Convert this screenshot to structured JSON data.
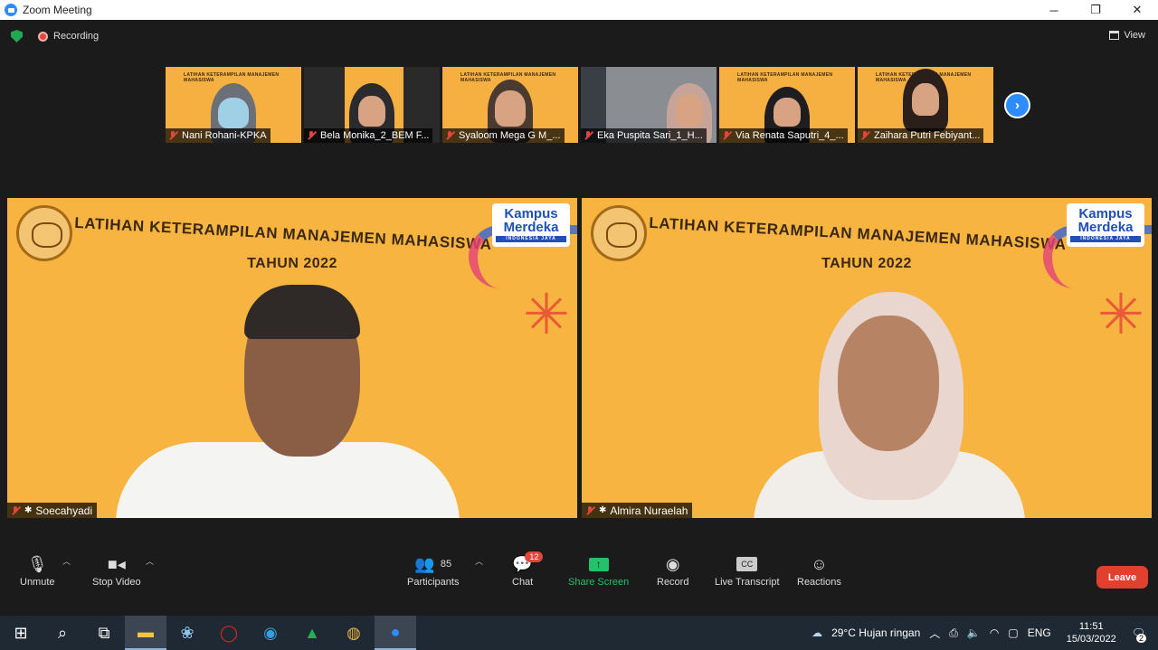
{
  "window": {
    "title": "Zoom Meeting",
    "minimize": "─",
    "maximize": "❐",
    "close": "✕"
  },
  "topbar": {
    "recording": "Recording",
    "view": "View"
  },
  "thumbnails": [
    {
      "name": "Nani Rohani-KPKA",
      "banner": "LATIHAN KETERAMPILAN MANAJEMEN MAHASISWA"
    },
    {
      "name": "Bela Monika_2_BEM F...",
      "banner": "LATIHAN KETERAMPILAN MANAJEMEN MAHASISWA"
    },
    {
      "name": "Syaloom Mega G M_...",
      "banner": "LATIHAN KETERAMPILAN MANAJEMEN MAHASISWA"
    },
    {
      "name": "Eka Puspita Sari_1_H...",
      "banner": ""
    },
    {
      "name": "Via Renata Saputri_4_...",
      "banner": "LATIHAN KETERAMPILAN MANAJEMEN MAHASISWA"
    },
    {
      "name": "Zaihara Putri Febiyant...",
      "banner": "LATIHAN KETERAMPILAN MANAJEMEN MAHASISWA"
    }
  ],
  "videos": [
    {
      "name": "Soecahyadi",
      "banner_title": "LATIHAN KETERAMPILAN MANAJEMEN MAHASISWA",
      "banner_year": "TAHUN 2022",
      "kampus": "Kampus Merdeka",
      "kampus_sub": "INDONESIA JAYA"
    },
    {
      "name": "Almira Nuraelah",
      "banner_title": "LATIHAN KETERAMPILAN MANAJEMEN MAHASISWA",
      "banner_year": "TAHUN 2022",
      "kampus": "Kampus Merdeka",
      "kampus_sub": "INDONESIA JAYA"
    }
  ],
  "toolbar": {
    "unmute": "Unmute",
    "stop_video": "Stop Video",
    "participants": "Participants",
    "participants_count": "85",
    "chat": "Chat",
    "chat_badge": "12",
    "share_screen": "Share Screen",
    "record": "Record",
    "live_transcript": "Live Transcript",
    "cc": "CC",
    "reactions": "Reactions",
    "leave": "Leave"
  },
  "taskbar": {
    "weather": "29°C  Hujan ringan",
    "lang": "ENG",
    "time": "11:51",
    "date": "15/03/2022",
    "notif_count": "2"
  },
  "colors": {
    "accent": "#2d8cff",
    "leave": "#e0402e",
    "share": "#24c06b",
    "banner": "#f7b440"
  }
}
